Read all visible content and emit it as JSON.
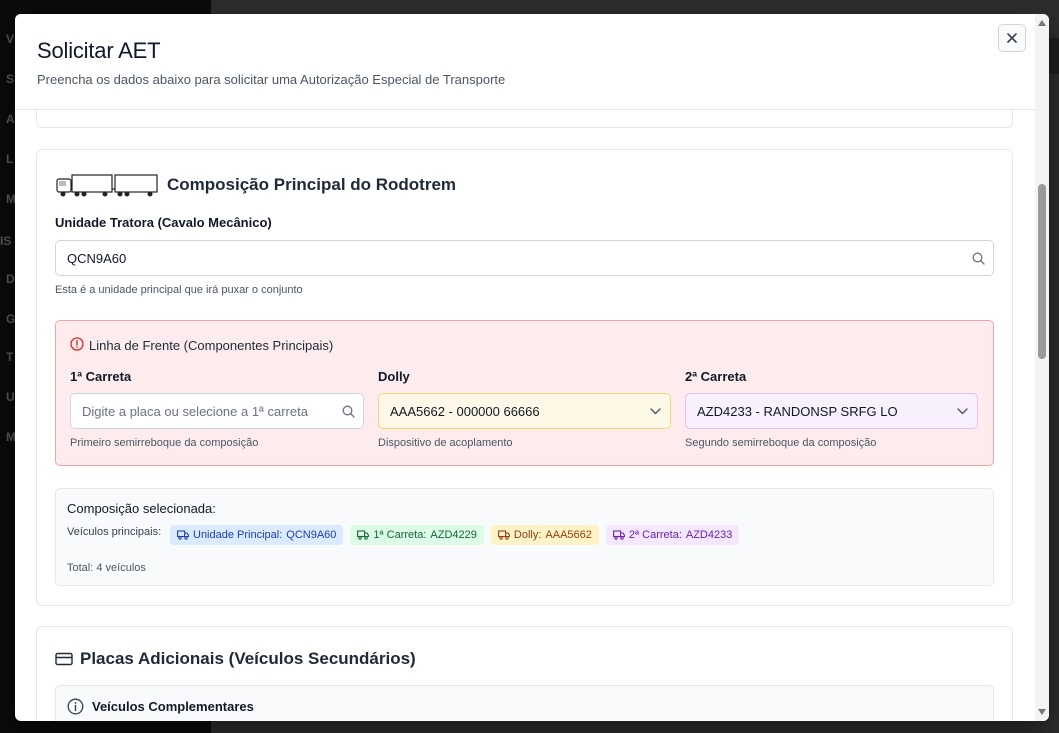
{
  "modal": {
    "title": "Solicitar AET",
    "subtitle": "Preencha os dados abaixo para solicitar uma Autorização Especial de Transporte"
  },
  "composition": {
    "title": "Composição Principal do Rodotrem",
    "tractor_label": "Unidade Tratora (Cavalo Mecânico)",
    "tractor_value": "QCN9A60",
    "tractor_help": "Esta é a unidade principal que irá puxar o conjunto",
    "front_line": {
      "title": "Linha de Frente (Componentes Principais)",
      "first_trailer": {
        "label": "1ª Carreta",
        "placeholder": "Digite a placa ou selecione a 1ª carreta",
        "help": "Primeiro semirreboque da composição"
      },
      "dolly": {
        "label": "Dolly",
        "value": "AAA5662 - 000000 66666",
        "help": "Dispositivo de acoplamento"
      },
      "second_trailer": {
        "label": "2ª Carreta",
        "value": "AZD4233 - RANDONSP SRFG LO",
        "help": "Segundo semirreboque da composição"
      }
    },
    "selected": {
      "title": "Composição selecionada:",
      "vehicles_label": "Veículos principais:",
      "badges": [
        {
          "prefix": "Unidade Principal:",
          "plate": "QCN9A60",
          "color": "#1e40af"
        },
        {
          "prefix": "1ª Carreta:",
          "plate": "AZD4229",
          "color": "#166534"
        },
        {
          "prefix": "Dolly:",
          "plate": "AAA5662",
          "color": "#92400e"
        },
        {
          "prefix": "2ª Carreta:",
          "plate": "AZD4233",
          "color": "#6b21a8"
        }
      ],
      "total": "Total: 4 veículos"
    }
  },
  "additional": {
    "title": "Placas Adicionais (Veículos Secundários)",
    "complementary_title": "Veículos Complementares"
  },
  "colors": {
    "front_line_bg": "#fdeced",
    "front_line_border": "#f3a3a7",
    "alert_icon": "#dc2626",
    "dolly_bg": "#fef9e6",
    "second_trailer_bg": "#f8f0fd"
  },
  "backdrop": {
    "letters": [
      "V",
      "S",
      "A",
      "L",
      "M",
      "IS",
      "D",
      "G",
      "T",
      "U",
      "M"
    ]
  }
}
